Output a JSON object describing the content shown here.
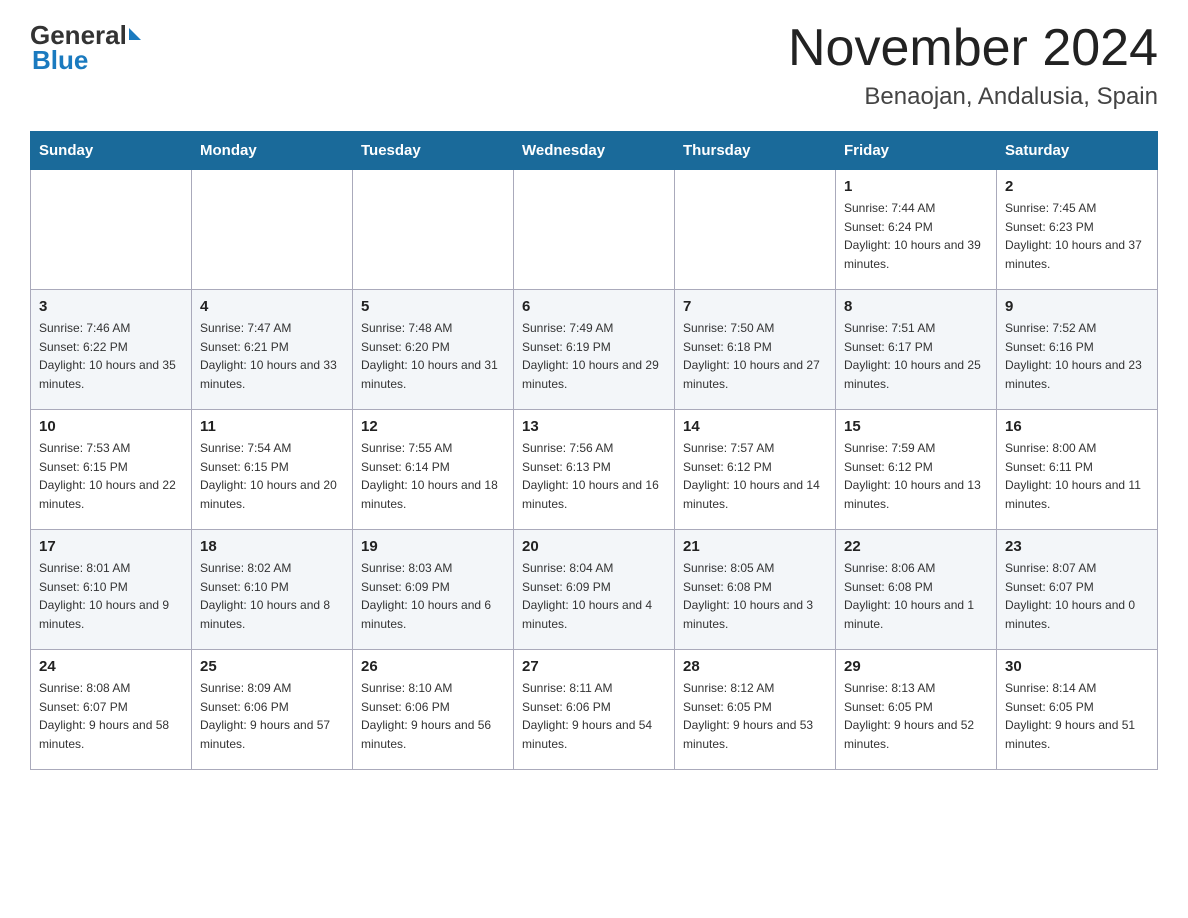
{
  "header": {
    "logo_general": "General",
    "logo_blue": "Blue",
    "month_title": "November 2024",
    "location": "Benaojan, Andalusia, Spain"
  },
  "days_of_week": [
    "Sunday",
    "Monday",
    "Tuesday",
    "Wednesday",
    "Thursday",
    "Friday",
    "Saturday"
  ],
  "weeks": [
    [
      {
        "day": "",
        "info": ""
      },
      {
        "day": "",
        "info": ""
      },
      {
        "day": "",
        "info": ""
      },
      {
        "day": "",
        "info": ""
      },
      {
        "day": "",
        "info": ""
      },
      {
        "day": "1",
        "info": "Sunrise: 7:44 AM\nSunset: 6:24 PM\nDaylight: 10 hours and 39 minutes."
      },
      {
        "day": "2",
        "info": "Sunrise: 7:45 AM\nSunset: 6:23 PM\nDaylight: 10 hours and 37 minutes."
      }
    ],
    [
      {
        "day": "3",
        "info": "Sunrise: 7:46 AM\nSunset: 6:22 PM\nDaylight: 10 hours and 35 minutes."
      },
      {
        "day": "4",
        "info": "Sunrise: 7:47 AM\nSunset: 6:21 PM\nDaylight: 10 hours and 33 minutes."
      },
      {
        "day": "5",
        "info": "Sunrise: 7:48 AM\nSunset: 6:20 PM\nDaylight: 10 hours and 31 minutes."
      },
      {
        "day": "6",
        "info": "Sunrise: 7:49 AM\nSunset: 6:19 PM\nDaylight: 10 hours and 29 minutes."
      },
      {
        "day": "7",
        "info": "Sunrise: 7:50 AM\nSunset: 6:18 PM\nDaylight: 10 hours and 27 minutes."
      },
      {
        "day": "8",
        "info": "Sunrise: 7:51 AM\nSunset: 6:17 PM\nDaylight: 10 hours and 25 minutes."
      },
      {
        "day": "9",
        "info": "Sunrise: 7:52 AM\nSunset: 6:16 PM\nDaylight: 10 hours and 23 minutes."
      }
    ],
    [
      {
        "day": "10",
        "info": "Sunrise: 7:53 AM\nSunset: 6:15 PM\nDaylight: 10 hours and 22 minutes."
      },
      {
        "day": "11",
        "info": "Sunrise: 7:54 AM\nSunset: 6:15 PM\nDaylight: 10 hours and 20 minutes."
      },
      {
        "day": "12",
        "info": "Sunrise: 7:55 AM\nSunset: 6:14 PM\nDaylight: 10 hours and 18 minutes."
      },
      {
        "day": "13",
        "info": "Sunrise: 7:56 AM\nSunset: 6:13 PM\nDaylight: 10 hours and 16 minutes."
      },
      {
        "day": "14",
        "info": "Sunrise: 7:57 AM\nSunset: 6:12 PM\nDaylight: 10 hours and 14 minutes."
      },
      {
        "day": "15",
        "info": "Sunrise: 7:59 AM\nSunset: 6:12 PM\nDaylight: 10 hours and 13 minutes."
      },
      {
        "day": "16",
        "info": "Sunrise: 8:00 AM\nSunset: 6:11 PM\nDaylight: 10 hours and 11 minutes."
      }
    ],
    [
      {
        "day": "17",
        "info": "Sunrise: 8:01 AM\nSunset: 6:10 PM\nDaylight: 10 hours and 9 minutes."
      },
      {
        "day": "18",
        "info": "Sunrise: 8:02 AM\nSunset: 6:10 PM\nDaylight: 10 hours and 8 minutes."
      },
      {
        "day": "19",
        "info": "Sunrise: 8:03 AM\nSunset: 6:09 PM\nDaylight: 10 hours and 6 minutes."
      },
      {
        "day": "20",
        "info": "Sunrise: 8:04 AM\nSunset: 6:09 PM\nDaylight: 10 hours and 4 minutes."
      },
      {
        "day": "21",
        "info": "Sunrise: 8:05 AM\nSunset: 6:08 PM\nDaylight: 10 hours and 3 minutes."
      },
      {
        "day": "22",
        "info": "Sunrise: 8:06 AM\nSunset: 6:08 PM\nDaylight: 10 hours and 1 minute."
      },
      {
        "day": "23",
        "info": "Sunrise: 8:07 AM\nSunset: 6:07 PM\nDaylight: 10 hours and 0 minutes."
      }
    ],
    [
      {
        "day": "24",
        "info": "Sunrise: 8:08 AM\nSunset: 6:07 PM\nDaylight: 9 hours and 58 minutes."
      },
      {
        "day": "25",
        "info": "Sunrise: 8:09 AM\nSunset: 6:06 PM\nDaylight: 9 hours and 57 minutes."
      },
      {
        "day": "26",
        "info": "Sunrise: 8:10 AM\nSunset: 6:06 PM\nDaylight: 9 hours and 56 minutes."
      },
      {
        "day": "27",
        "info": "Sunrise: 8:11 AM\nSunset: 6:06 PM\nDaylight: 9 hours and 54 minutes."
      },
      {
        "day": "28",
        "info": "Sunrise: 8:12 AM\nSunset: 6:05 PM\nDaylight: 9 hours and 53 minutes."
      },
      {
        "day": "29",
        "info": "Sunrise: 8:13 AM\nSunset: 6:05 PM\nDaylight: 9 hours and 52 minutes."
      },
      {
        "day": "30",
        "info": "Sunrise: 8:14 AM\nSunset: 6:05 PM\nDaylight: 9 hours and 51 minutes."
      }
    ]
  ]
}
